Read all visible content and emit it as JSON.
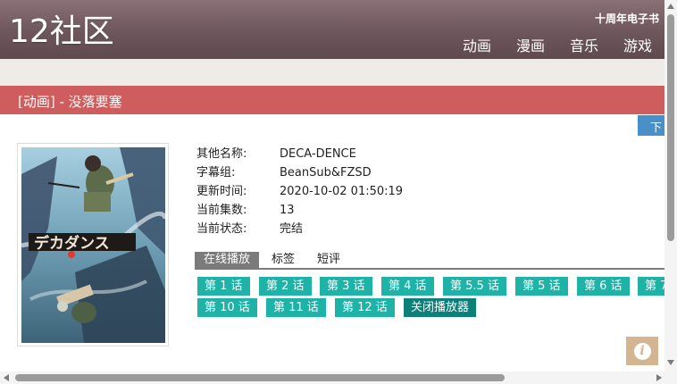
{
  "header": {
    "logo": "12社区",
    "anniversary_link": "十周年电子书",
    "nav": [
      "动画",
      "漫画",
      "音乐",
      "游戏"
    ]
  },
  "section": {
    "title": "[动画] - 没落要塞"
  },
  "download_label": "下",
  "poster": {
    "icon": "anime-poster-image"
  },
  "info": [
    {
      "label": "其他名称:",
      "value": "DECA-DENCE"
    },
    {
      "label": "字幕组:",
      "value": "BeanSub&FZSD"
    },
    {
      "label": "更新时间:",
      "value": "2020-10-02 01:50:19"
    },
    {
      "label": "当前集数:",
      "value": "13"
    },
    {
      "label": "当前状态:",
      "value": "完结"
    }
  ],
  "tabs": [
    "在线播放",
    "标签",
    "短评"
  ],
  "episodes": [
    "第 1 话",
    "第 2 话",
    "第 3 话",
    "第 4 话",
    "第 5.5 话",
    "第 5 话",
    "第 6 话",
    "第 7",
    "第 10 话",
    "第 11 话",
    "第 12 话"
  ],
  "close_player": "关闭播放器",
  "colors": {
    "header": "#6d565c",
    "section_bar": "#cf5d5d",
    "episode_button": "#1fb3a8",
    "close_button": "#0c7f78",
    "tab_active": "#7b7b7b"
  }
}
